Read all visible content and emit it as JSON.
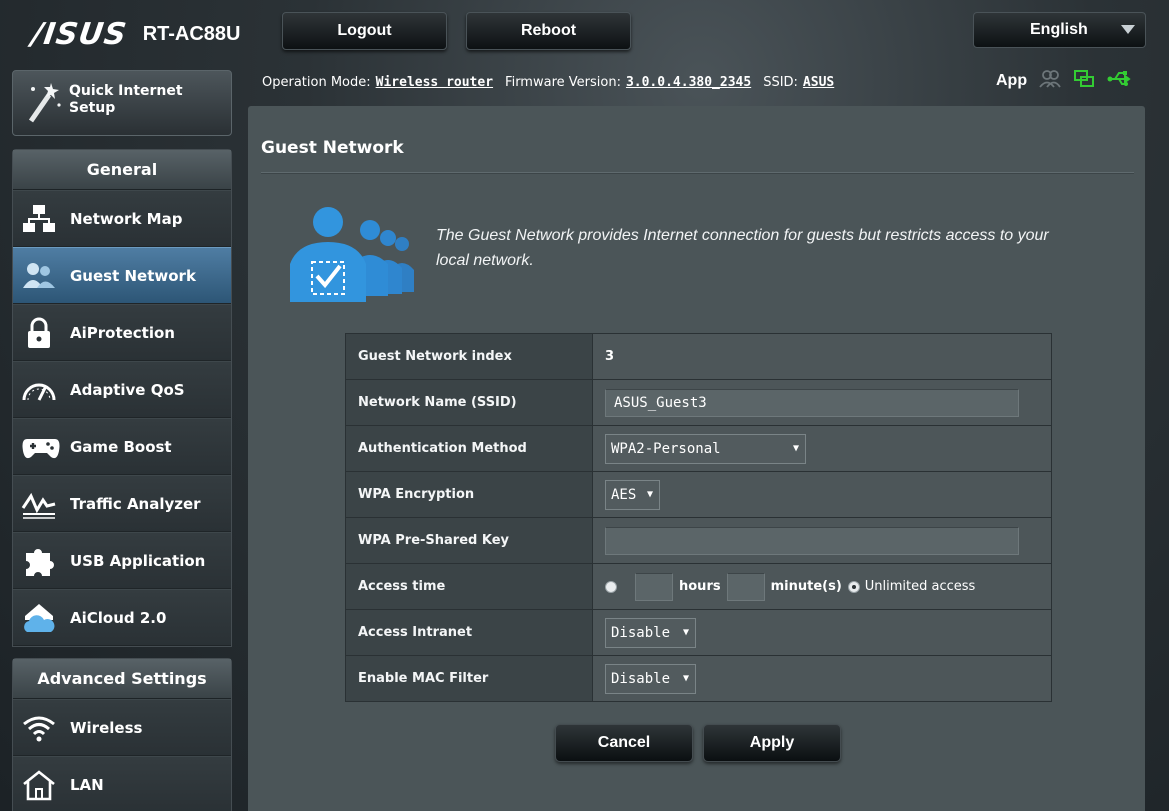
{
  "header": {
    "brand": "/ISUS",
    "model": "RT-AC88U",
    "logout_label": "Logout",
    "reboot_label": "Reboot",
    "language": "English"
  },
  "status": {
    "op_mode_label": "Operation Mode:",
    "op_mode_value": "Wireless router",
    "firmware_label": "Firmware Version:",
    "firmware_value": "3.0.0.4.380_2345",
    "ssid_label": "SSID:",
    "ssid_value": "ASUS",
    "app_label": "App",
    "icons": [
      "users-icon",
      "network-status-icon",
      "usb-icon"
    ],
    "status_color": "#33cc33"
  },
  "sidebar": {
    "quick_setup": "Quick Internet Setup",
    "general_header": "General",
    "general_items": [
      {
        "label": "Network Map",
        "icon": "network-map-icon"
      },
      {
        "label": "Guest Network",
        "icon": "guest-network-icon",
        "active": true
      },
      {
        "label": "AiProtection",
        "icon": "lock-icon"
      },
      {
        "label": "Adaptive QoS",
        "icon": "gauge-icon"
      },
      {
        "label": "Game Boost",
        "icon": "gamepad-icon"
      },
      {
        "label": "Traffic Analyzer",
        "icon": "traffic-chart-icon"
      },
      {
        "label": "USB Application",
        "icon": "puzzle-icon"
      },
      {
        "label": "AiCloud 2.0",
        "icon": "cloud-house-icon"
      }
    ],
    "advanced_header": "Advanced Settings",
    "advanced_items": [
      {
        "label": "Wireless",
        "icon": "wifi-icon"
      },
      {
        "label": "LAN",
        "icon": "house-icon"
      }
    ]
  },
  "main": {
    "title": "Guest Network",
    "description": "The Guest Network provides Internet connection for guests but restricts access to your local network.",
    "form": {
      "index_label": "Guest Network index",
      "index_value": "3",
      "ssid_label": "Network Name (SSID)",
      "ssid_value": "ASUS_Guest3",
      "auth_label": "Authentication Method",
      "auth_value": "WPA2-Personal",
      "enc_label": "WPA Encryption",
      "enc_value": "AES",
      "psk_label": "WPA Pre-Shared Key",
      "psk_value": "",
      "access_time_label": "Access time",
      "hours_label": "hours",
      "minutes_label": "minute(s)",
      "unlimited_label": "Unlimited access",
      "intranet_label": "Access Intranet",
      "intranet_value": "Disable",
      "mac_filter_label": "Enable MAC Filter",
      "mac_filter_value": "Disable"
    },
    "cancel_label": "Cancel",
    "apply_label": "Apply"
  }
}
